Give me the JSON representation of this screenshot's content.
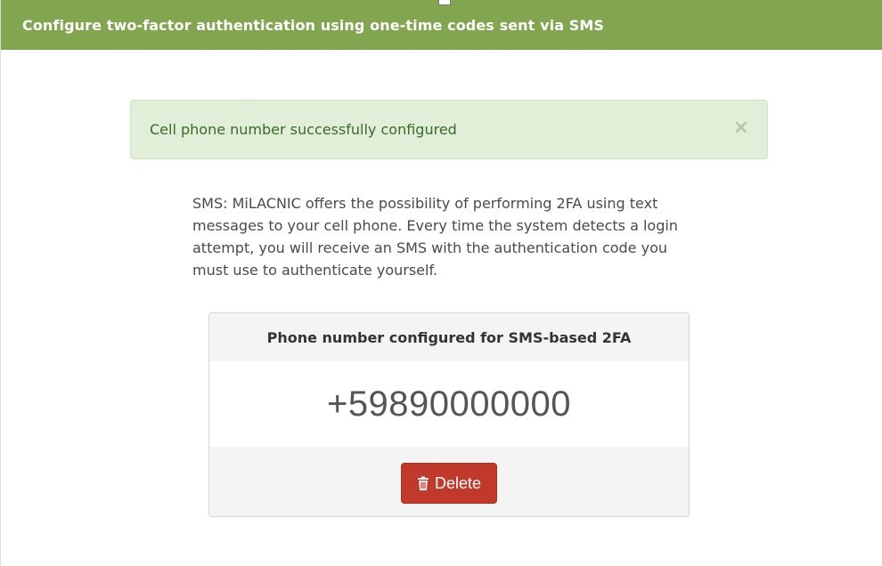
{
  "header": {
    "title": "Configure two-factor authentication using one-time codes sent via SMS"
  },
  "alert": {
    "message": "Cell phone number successfully configured",
    "close_symbol": "×",
    "close_icon": "close-icon"
  },
  "description": {
    "text": "SMS: MiLACNIC offers the possibility of performing 2FA using text messages to your cell phone. Every time the system detects a login attempt, you will receive an SMS with the authentication code you must use to authenticate yourself."
  },
  "phone_card": {
    "heading": "Phone number configured for SMS-based 2FA",
    "phone_number": "+59890000000",
    "delete_label": "Delete",
    "delete_icon": "trash-icon"
  },
  "colors": {
    "header_green": "#82a550",
    "alert_bg": "#e1eed8",
    "alert_text": "#3b6b2a",
    "danger": "#c0392b"
  }
}
